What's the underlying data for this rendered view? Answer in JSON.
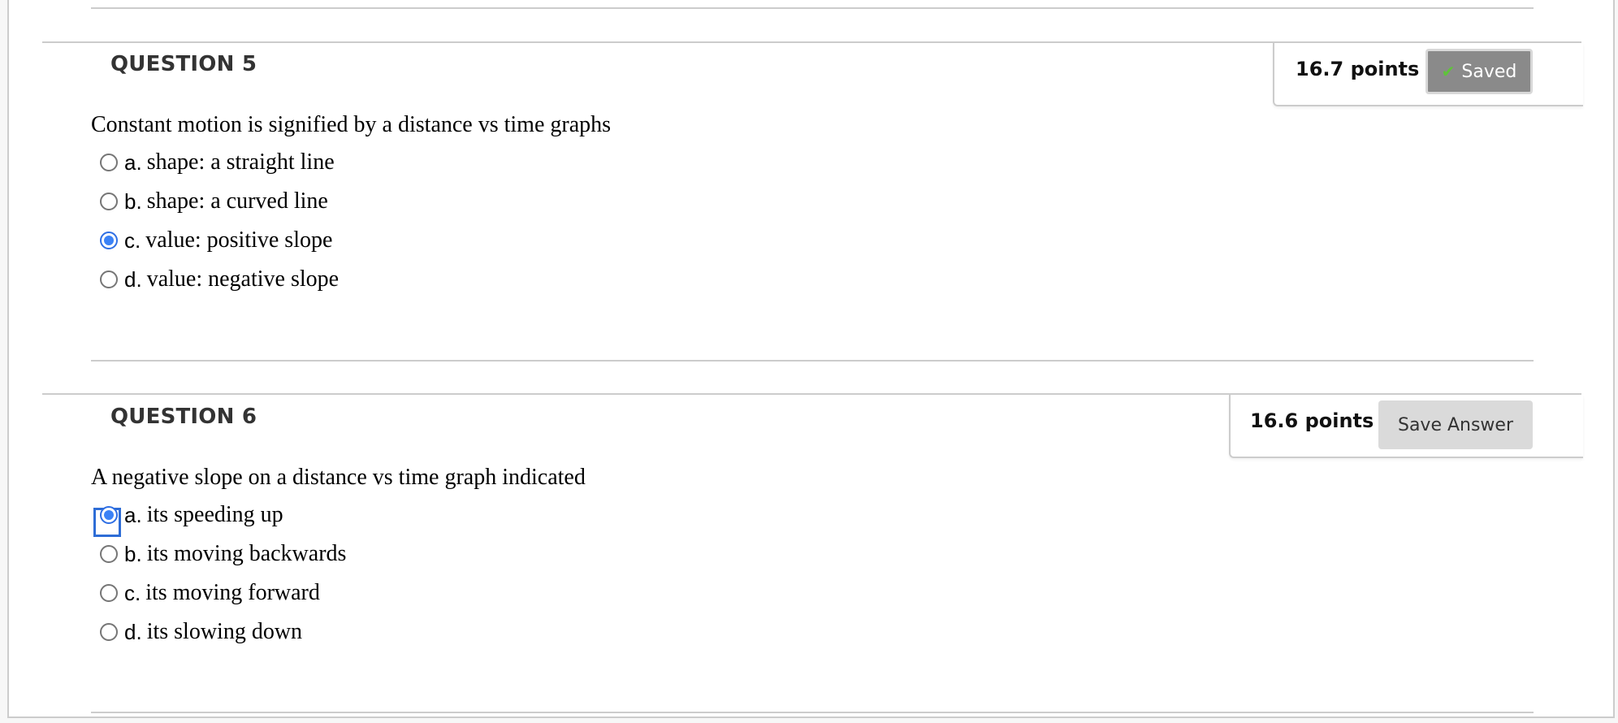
{
  "questions": [
    {
      "title": "QUESTION 5",
      "points": "16.7 points",
      "status_button": {
        "label": "Saved",
        "icon": "check-icon",
        "state": "saved",
        "color": "#8a8a8a",
        "icon_color": "#5fc33a"
      },
      "prompt": "Constant motion is signified by a distance vs time graphs",
      "options": [
        {
          "letter": "a.",
          "text": "shape: a straight line",
          "selected": false
        },
        {
          "letter": "b.",
          "text": "shape: a curved line",
          "selected": false
        },
        {
          "letter": "c.",
          "text": "value: positive slope",
          "selected": true
        },
        {
          "letter": "d.",
          "text": "value: negative slope",
          "selected": false
        }
      ]
    },
    {
      "title": "QUESTION 6",
      "points": "16.6 points",
      "status_button": {
        "label": "Save Answer",
        "state": "unsaved",
        "color": "#dadada"
      },
      "prompt": "A negative slope on a distance vs time graph indicated",
      "options": [
        {
          "letter": "a.",
          "text": "its speeding up",
          "selected": true,
          "focused": true
        },
        {
          "letter": "b.",
          "text": "its moving backwards",
          "selected": false
        },
        {
          "letter": "c.",
          "text": "its moving forward",
          "selected": false
        },
        {
          "letter": "d.",
          "text": "its slowing down",
          "selected": false
        }
      ]
    }
  ],
  "colors": {
    "radio_selected": "#3b82f6",
    "focus_ring": "#2e6dd6",
    "divider": "#cccccc"
  }
}
